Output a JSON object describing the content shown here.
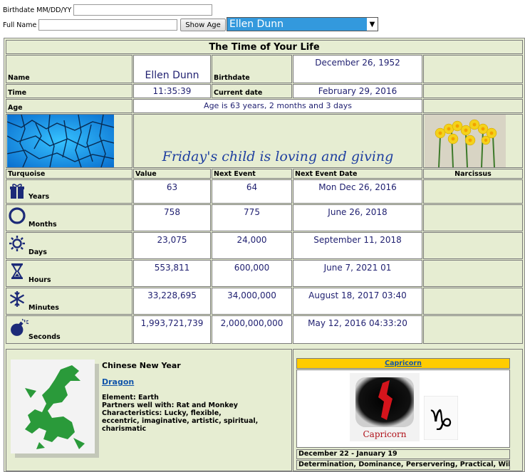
{
  "form": {
    "birthdate_label": "Birthdate MM/DD/YY",
    "birthdate_value": "",
    "fullname_label": "Full Name",
    "fullname_value": "",
    "show_button": "Show Age",
    "select_value": "Ellen Dunn"
  },
  "header": {
    "title": "The Time of Your Life",
    "name_label": "Name",
    "name_value": "Ellen Dunn",
    "birthdate_label": "Birthdate",
    "birthdate_value": "December 26, 1952",
    "time_label": "Time",
    "time_value": "11:35:39",
    "current_label": "Current date",
    "current_value": "February 29, 2016",
    "age_label": "Age",
    "age_value": "Age is 63 years, 2 months and 3 days",
    "saying": "Friday's child is loving and giving"
  },
  "columns": {
    "stone": "Turquoise",
    "value": "Value",
    "next": "Next Event",
    "date": "Next Event Date",
    "flower": "Narcissus"
  },
  "rows": [
    {
      "unit": "Years",
      "value": "63",
      "next": "64",
      "date": "Mon Dec 26, 2016"
    },
    {
      "unit": "Months",
      "value": "758",
      "next": "775",
      "date": "June 26, 2018"
    },
    {
      "unit": "Days",
      "value": "23,075",
      "next": "24,000",
      "date": "September 11, 2018"
    },
    {
      "unit": "Hours",
      "value": "553,811",
      "next": "600,000",
      "date": "June 7, 2021 01"
    },
    {
      "unit": "Minutes",
      "value": "33,228,695",
      "next": "34,000,000",
      "date": "August 18, 2017 03:40"
    },
    {
      "unit": "Seconds",
      "value": "1,993,721,739",
      "next": "2,000,000,000",
      "date": "May 12, 2016 04:33:20"
    }
  ],
  "chinese": {
    "heading": "Chinese New Year",
    "animal": "Dragon",
    "element": "Element: Earth",
    "partners": "Partners well with: Rat and Monkey",
    "characteristics": "Characteristics: Lucky, flexible,",
    "characteristics2": "eccentric, imaginative, artistic, spiritual, charismatic"
  },
  "zodiac": {
    "sign": "Capricorn",
    "image_caption": "Capricorn",
    "dates": "December 22 - January 19",
    "traits": "Determination, Dominance, Perservering, Practical, Willful"
  },
  "colors": {
    "panel": "#e6edd2",
    "value_text": "#1f1f70",
    "select_bg": "#3399dd",
    "zodiac_header": "#ffcc00",
    "dragon_green": "#2a9a3a"
  }
}
